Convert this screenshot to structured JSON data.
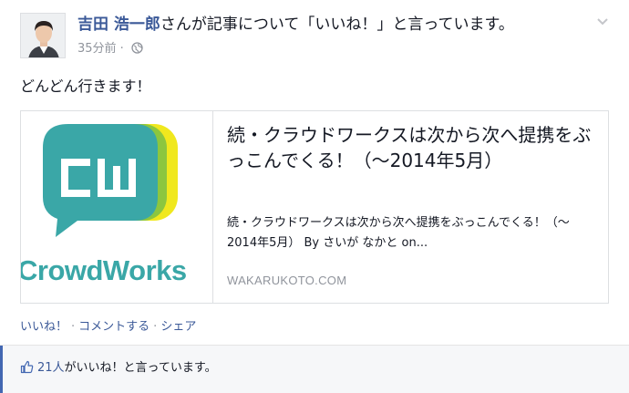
{
  "story": {
    "actor_name": "吉田 浩一郎",
    "action_text": "さんが記事について「いいね！」と言っています。",
    "timestamp": "35分前",
    "separator": " · ",
    "message": "どんどん行きます！"
  },
  "attachment": {
    "title": "続・クラウドワークスは次から次へ提携をぶっこんでくる！（〜2014年5月）",
    "description": "続・クラウドワークスは次から次へ提携をぶっこんでくる！（〜2014年5月） By さいが なかと on...",
    "source": "WAKARUKOTO.COM",
    "thumbnail": {
      "logo_letters": "CW",
      "wordmark": "CrowdWorks",
      "colors": {
        "teal": "#3aa7a7",
        "green": "#8cc63f",
        "yellow": "#f0e81e"
      }
    }
  },
  "actions": {
    "like": "いいね！",
    "comment": "コメントする",
    "share": "シェア",
    "separator": "·"
  },
  "likes": {
    "count_text": "21人",
    "suffix": "がいいね！と言っています。"
  },
  "colors": {
    "link": "#3b5998",
    "meta": "#90949c",
    "text": "#141823",
    "accent": "#4267b2"
  },
  "icons": [
    "avatar",
    "globe-icon",
    "chevron-down-icon",
    "thumbs-up-icon"
  ]
}
